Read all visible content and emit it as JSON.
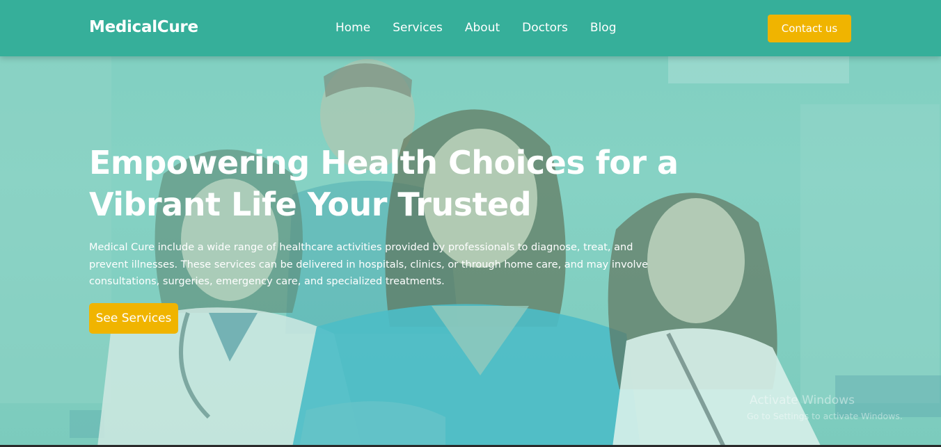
{
  "header": {
    "logo": "MedicalCure",
    "nav": [
      "Home",
      "Services",
      "About",
      "Doctors",
      "Blog"
    ],
    "contact_label": "Contact us"
  },
  "hero": {
    "title_line1": "Empowering Health Choices for a",
    "title_line2": "Vibrant Life Your Trusted",
    "description_line1": "Medical Cure include a wide range of healthcare activities provided by professionals to diagnose, treat, and",
    "description_line2": "prevent illnesses. These services can be delivered in hospitals, clinics, or through home care, and may involve",
    "description_line3": "consultations, surgeries, emergency care, and specialized treatments.",
    "cta_label": "See Services"
  },
  "watermark": {
    "title": "Activate Windows",
    "subtitle": "Go to Settings to activate Windows."
  },
  "colors": {
    "header_bg": "#36af9a",
    "accent": "#f0b400",
    "overlay": "#7fcfc0"
  }
}
